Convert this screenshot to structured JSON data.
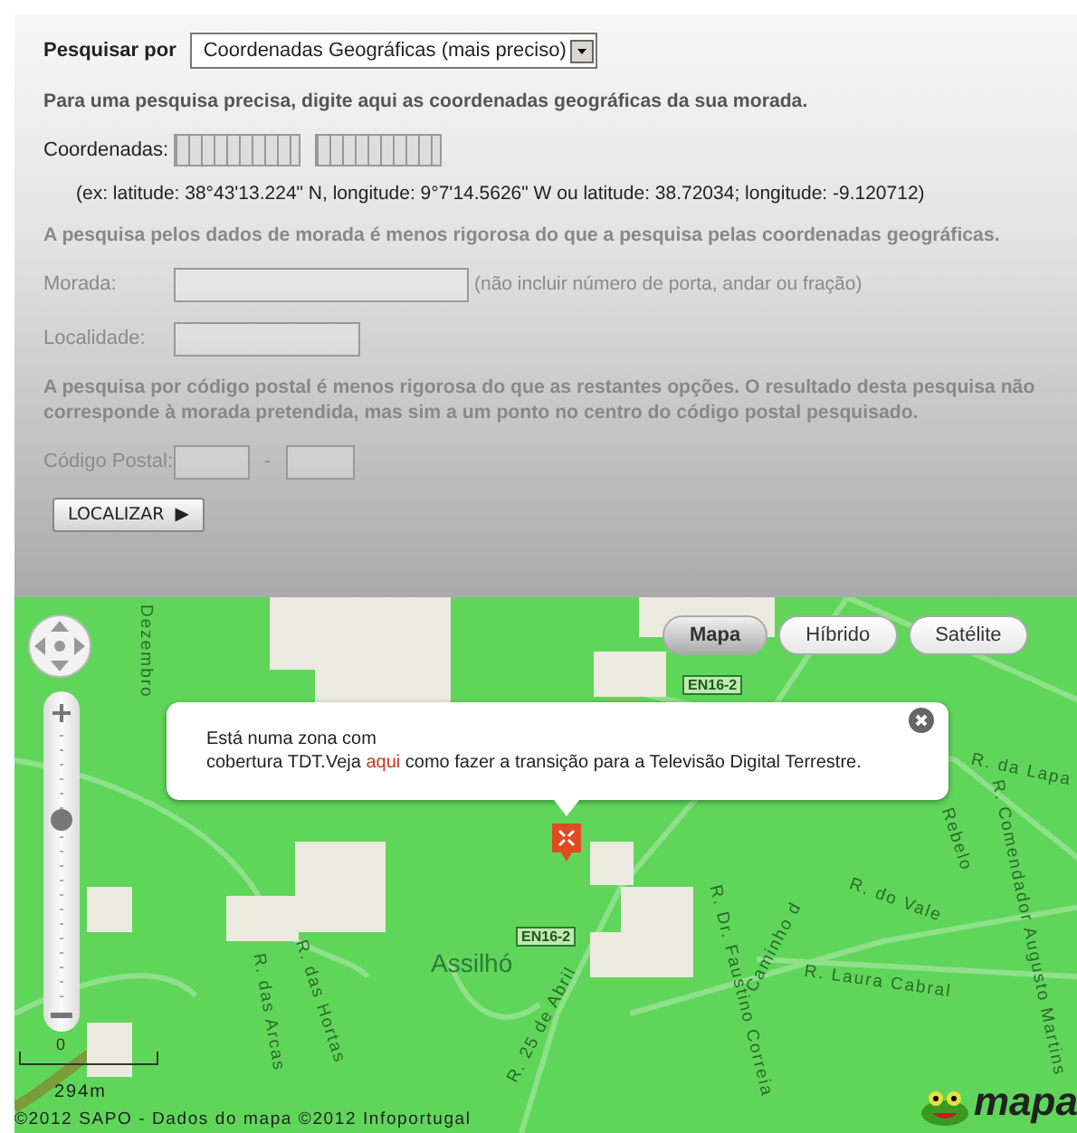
{
  "search_by": {
    "label": "Pesquisar por",
    "value": "Coordenadas Geográficas (mais preciso)"
  },
  "coordinates": {
    "intro": "Para uma pesquisa precisa, digite aqui as coordenadas geográficas da sua morada.",
    "label": "Coordenadas:",
    "example": "(ex: latitude: 38°43'13.224\" N, longitude: 9°7'14.5626\" W ou latitude: 38.72034; longitude: -9.120712)",
    "disabled": false
  },
  "address": {
    "intro": "A pesquisa pelos dados de morada é menos rigorosa do que a pesquisa pelas coordenadas geográficas.",
    "morada_label": "Morada:",
    "morada_hint": "(não incluir número de porta, andar ou fração)",
    "localidade_label": "Localidade:",
    "disabled": true
  },
  "postal": {
    "intro": "A pesquisa por código postal é menos rigorosa do que as restantes opções. O resultado desta pesquisa não corresponde à morada pretendida, mas sim a um ponto no centro do código postal pesquisado.",
    "label": "Código Postal:",
    "separator": "-",
    "disabled": true
  },
  "locate_button": {
    "label": "LOCALIZAR",
    "icon": "▶"
  },
  "map": {
    "map_types": [
      {
        "label": "Mapa",
        "selected": true
      },
      {
        "label": "Híbrido",
        "selected": false
      },
      {
        "label": "Satélite",
        "selected": false
      }
    ],
    "zoom_slider": {
      "level": 0.68
    },
    "popup": {
      "line_1": "Está numa zona com",
      "line_2_before": "cobertura TDT.Veja ",
      "link": "aqui",
      "line_2_after": " como fazer a transição para a Televisão Digital Terrestre."
    },
    "street_labels": [
      {
        "text": "Dezembro",
        "kind": "street"
      },
      {
        "text": "EN16-2",
        "kind": "road-code"
      },
      {
        "text": "EN16-2",
        "kind": "road-code"
      },
      {
        "text": "Assilhó",
        "kind": "place"
      },
      {
        "text": "R. da Lapa",
        "kind": "street"
      },
      {
        "text": "R. do Vale",
        "kind": "street"
      },
      {
        "text": "R. Laura Cabral",
        "kind": "street"
      },
      {
        "text": "R. Comendador Augusto Martins",
        "kind": "street"
      },
      {
        "text": "R. das Hortas",
        "kind": "street"
      },
      {
        "text": "R. das Arcas",
        "kind": "street"
      },
      {
        "text": "R. 25 de Abril",
        "kind": "street"
      },
      {
        "text": "R. Dr. Faustino Correia",
        "kind": "street"
      },
      {
        "text": "Rebelo",
        "kind": "street"
      },
      {
        "text": "Caminho d",
        "kind": "street"
      }
    ],
    "scale": {
      "zero": "0",
      "distance": "294m"
    },
    "attribution": "©2012 SAPO - Dados do mapa ©2012 Infoportugal",
    "logo_text": "mapa"
  }
}
